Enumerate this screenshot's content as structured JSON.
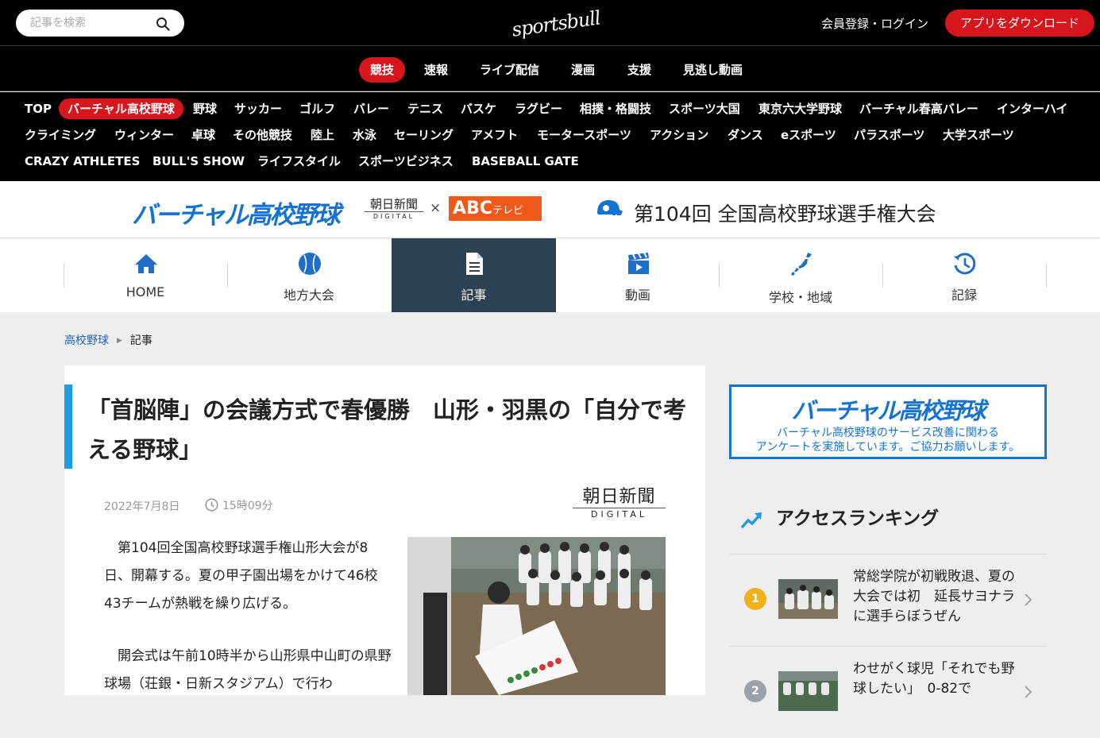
{
  "header": {
    "search_placeholder": "記事を検索",
    "logo_text": "sportsbull",
    "login_label": "会員登録・ログイン",
    "app_button_label": "アプリをダウンロード"
  },
  "categories": [
    {
      "label": "競技",
      "active": true
    },
    {
      "label": "速報",
      "active": false
    },
    {
      "label": "ライブ配信",
      "active": false
    },
    {
      "label": "漫画",
      "active": false
    },
    {
      "label": "支援",
      "active": false
    },
    {
      "label": "見逃し動画",
      "active": false
    }
  ],
  "sports_nav": [
    {
      "label": "TOP"
    },
    {
      "label": "バーチャル高校野球",
      "active": true
    },
    {
      "label": "野球"
    },
    {
      "label": "サッカー"
    },
    {
      "label": "ゴルフ"
    },
    {
      "label": "バレー"
    },
    {
      "label": "テニス"
    },
    {
      "label": "バスケ"
    },
    {
      "label": "ラグビー"
    },
    {
      "label": "相撲・格闘技"
    },
    {
      "label": "スポーツ大国"
    },
    {
      "label": "東京六大学野球"
    },
    {
      "label": "バーチャル春高バレー"
    },
    {
      "label": "インターハイ"
    },
    {
      "label": "クライミング"
    },
    {
      "label": "ウィンター"
    },
    {
      "label": "卓球"
    },
    {
      "label": "その他競技"
    },
    {
      "label": "陸上"
    },
    {
      "label": "水泳"
    },
    {
      "label": "セーリング"
    },
    {
      "label": "アメフト"
    },
    {
      "label": "モータースポーツ"
    },
    {
      "label": "アクション"
    },
    {
      "label": "ダンス"
    },
    {
      "label": "eスポーツ"
    },
    {
      "label": "パラスポーツ"
    },
    {
      "label": "大学スポーツ"
    },
    {
      "label": "CRAZY ATHLETES"
    },
    {
      "label": "BULL'S SHOW"
    },
    {
      "label": "ライフスタイル"
    },
    {
      "label": "スポーツビジネス"
    },
    {
      "label": "BASEBALL GATE"
    }
  ],
  "banner": {
    "logo_text": "バーチャル高校野球",
    "asahi_name": "朝日新聞",
    "asahi_sub": "DIGITAL",
    "cross": "×",
    "abc_label": "ABC",
    "abc_tv": "テレビ",
    "tournament_title": "第104回 全国高校野球選手権大会"
  },
  "sub_nav": [
    {
      "label": "HOME",
      "icon": "home-icon"
    },
    {
      "label": "地方大会",
      "icon": "baseball-icon"
    },
    {
      "label": "記事",
      "icon": "document-icon",
      "active": true
    },
    {
      "label": "動画",
      "icon": "clapperboard-icon"
    },
    {
      "label": "学校・地域",
      "icon": "japan-map-icon"
    },
    {
      "label": "記録",
      "icon": "history-icon"
    }
  ],
  "breadcrumb": {
    "parent": "高校野球",
    "current": "記事"
  },
  "article": {
    "headline": "「首脳陣」の会議方式で春優勝　山形・羽黒の「自分で考える野球」",
    "date": "2022年7月8日",
    "time": "15時09分",
    "source_name": "朝日新聞",
    "source_sub": "DIGITAL",
    "paragraphs": [
      "第104回全国高校野球選手権山形大会が8日、開幕する。夏の甲子園出場をかけて46校43チームが熱戦を繰り広げる。",
      "開会式は午前10時半から山形県中山町の県野球場（荘銀・日新スタジアム）で行わ"
    ]
  },
  "sidebar": {
    "banner_title": "バーチャル高校野球",
    "banner_line1": "バーチャル高校野球のサービス改善に関わる",
    "banner_line2": "アンケートを実施しています。ご協力お願いします。",
    "ranking_title": "アクセスランキング",
    "ranking": [
      {
        "rank": "1",
        "title": "常総学院が初戦敗退、夏の大会では初　延長サヨナラに選手らぼうぜん",
        "color": "#f0b119"
      },
      {
        "rank": "2",
        "title": "わせがく球児「それでも野球したい」　0-82で",
        "color": "#9aa1a8"
      }
    ]
  }
}
